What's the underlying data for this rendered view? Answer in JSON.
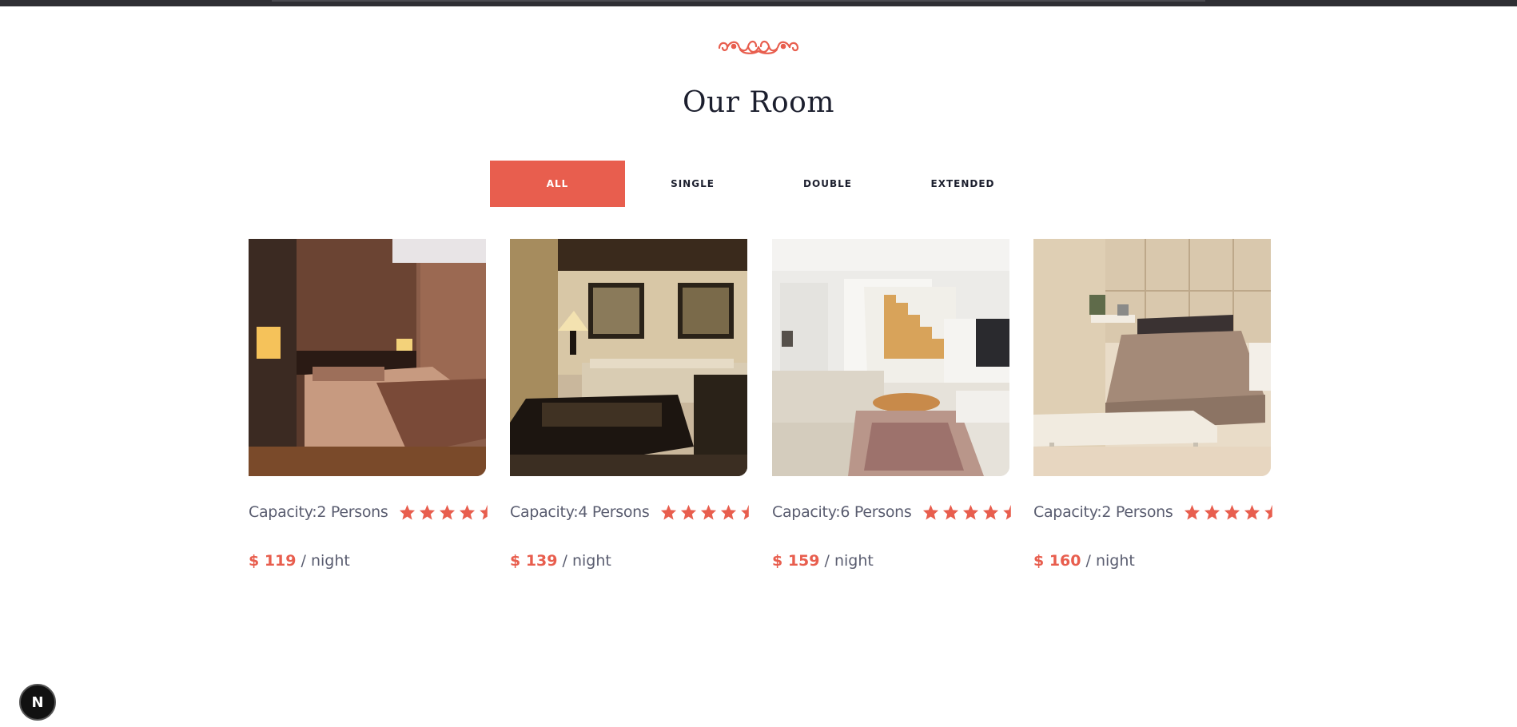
{
  "section": {
    "title": "Our Room"
  },
  "filters": [
    {
      "label": "ALL",
      "active": true
    },
    {
      "label": "SINGLE",
      "active": false
    },
    {
      "label": "DOUBLE",
      "active": false
    },
    {
      "label": "EXTENDED",
      "active": false
    }
  ],
  "rooms": [
    {
      "capacity": "Capacity:2 Persons",
      "rating": 4.5,
      "price": "$ 119",
      "unit": "/ night",
      "image": "bedroom-brown-photo"
    },
    {
      "capacity": "Capacity:4 Persons",
      "rating": 4.5,
      "price": "$ 139",
      "unit": "/ night",
      "image": "living-room-photo"
    },
    {
      "capacity": "Capacity:6 Persons",
      "rating": 4.5,
      "price": "$ 159",
      "unit": "/ night",
      "image": "staircase-lounge-photo"
    },
    {
      "capacity": "Capacity:2 Persons",
      "rating": 4.5,
      "price": "$ 160",
      "unit": "/ night",
      "image": "bedroom-cream-photo"
    }
  ],
  "colors": {
    "accent": "#e85e4e",
    "heading": "#1c1f2e",
    "body_text": "#5a5d70"
  },
  "badge": {
    "label": "N"
  }
}
